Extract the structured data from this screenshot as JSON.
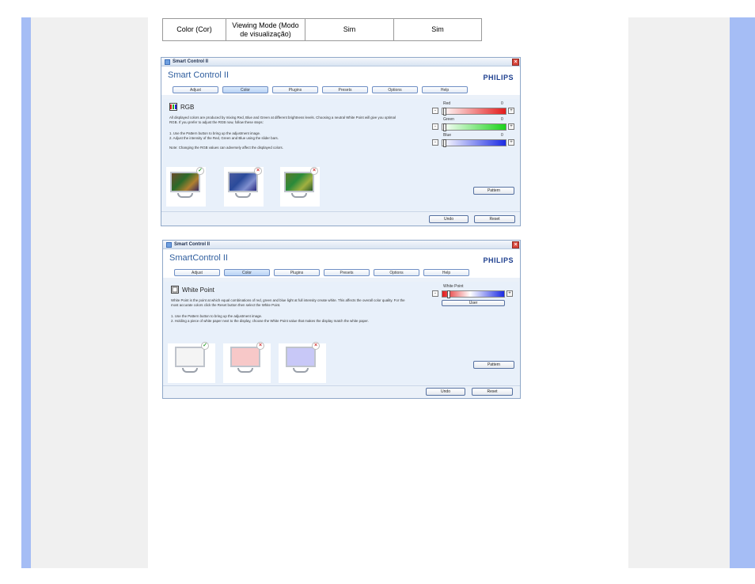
{
  "table": {
    "rows": [
      [
        "Color (Cor)",
        "Viewing Mode (Modo de visualização)",
        "Sim",
        "Sim"
      ]
    ]
  },
  "window1": {
    "titlebar": "Smart Control II",
    "app_title": "Smart Control II",
    "brand": "PHILIPS",
    "tabs": [
      "Adjust",
      "Color",
      "Plugins",
      "Presets",
      "Options",
      "Help"
    ],
    "active_tab": "Color",
    "section_title": "RGB",
    "paragraphs": [
      "All displayed colors are produced by mixing Red, Blue and Green at different brightness levels. Choosing a neutral White Point will give you optimal RGB. If you prefer to adjust the RGB now, follow these steps:",
      "1. Use the Pattern button to bring up the adjustment image.",
      "2. Adjust the intensity of the Red, Green and Blue using the slider bars.",
      "Note: Changing the RGB values can adversely affect the displayed colors."
    ],
    "sliders": [
      {
        "label": "Red",
        "value": "0",
        "color": "#e31b1b"
      },
      {
        "label": "Green",
        "value": "0",
        "color": "#1bd31b"
      },
      {
        "label": "Blue",
        "value": "0",
        "color": "#1b2be3"
      }
    ],
    "pattern_label": "Pattern",
    "undo_label": "Undo",
    "reset_label": "Reset"
  },
  "window2": {
    "titlebar": "Smart Control II",
    "app_title": "SmartControl II",
    "brand": "PHILIPS",
    "tabs": [
      "Adjust",
      "Color",
      "Plugins",
      "Presets",
      "Options",
      "Help"
    ],
    "active_tab": "Color",
    "section_title": "White Point",
    "paragraphs": [
      "White Point is the point at which equal combinations of red, green and blue light at full intensity create white. This affects the overall color quality. For the most accurate colors click the Reset button then select the White Point.",
      "1. Use the Pattern button to bring up the adjustment image.",
      "2. Holding a piece of white paper next to the display, choose the White Point value that makes the display match the white paper."
    ],
    "slider_label": "White Point",
    "slider_value_label": "User",
    "pattern_label": "Pattern",
    "undo_label": "Undo",
    "reset_label": "Reset"
  },
  "colors": {
    "page_blue": "#a5bdf5",
    "page_gray": "#f0f0f0",
    "brand_blue": "#1d3f8f"
  }
}
